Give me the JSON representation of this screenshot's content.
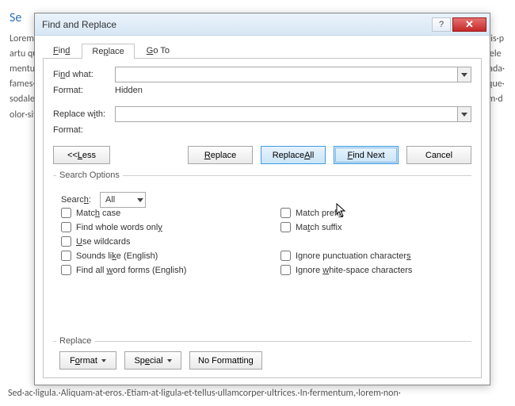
{
  "document": {
    "heading": "Se",
    "bg_text": "Lorem·ipsum·dolor·sit·amet.·Nam·at·magna.·Nullam·aliquet·massa·posuere·diam.·Cum·sociis·natoque·penatibus·et·magnis·dis·partu quis·mi.·Cras·auctor·libero·vitae·sem·vestibulum·euismod.·Sed·ve tristi·adipiscing·mauris·pellentesque·erat.·Sed·aliquet·elementum·erat.·vestit et·orci.·Donec·lacus·Aliquam·mauris.·Pellentesque·habitant·morbi·tristique·senectus·et·netus·et·malesuada·fames·ac·turpis·egestas.·mauris. scelerisque·sem·viverra·malesuada.·vestibulum·molestie·odio·a·nulla.·Aenean·at·lacus·tristique·sodales·congue·nisl·ut·sem·convallis.·Mauris·sollici Do lacini·magna·eget·ipsum.·Quisque·rutrum·augue·non·orci.·Lorem·ipsum·dolor·sit·amet·consectetuer·adipiscing·elit.·Mauris·vel·la.·vulpe.·in·nec·massa·quis·mi·porttitor·consequat.·¶",
    "footer_text": "Sed·ac·ligula.·Aliquam·at·eros.·Etiam·at·ligula·et·tellus·ullamcorper·ultrices.·In·fermentum,·lorem·non·"
  },
  "dialog": {
    "title": "Find and Replace",
    "tabs": {
      "find": "Find",
      "replace": "Replace",
      "goto": "Go To"
    },
    "find_what_label": "Find what:",
    "find_format_label": "Format:",
    "find_format_value": "Hidden",
    "replace_with_label": "Replace with:",
    "replace_format_label": "Format:",
    "buttons": {
      "less": "<< Less",
      "replace": "Replace",
      "replace_all": "Replace All",
      "find_next": "Find Next",
      "cancel": "Cancel"
    },
    "search_options_legend": "Search Options",
    "search_label": "Search:",
    "search_value": "All",
    "checkboxes": {
      "match_case": "Match case",
      "whole_words": "Find whole words only",
      "use_wildcards": "Use wildcards",
      "sounds_like": "Sounds like (English)",
      "word_forms": "Find all word forms (English)",
      "match_prefix": "Match prefix",
      "match_suffix": "Match suffix",
      "ignore_punct": "Ignore punctuation characters",
      "ignore_ws": "Ignore white-space characters"
    },
    "replace_legend": "Replace",
    "footer": {
      "format": "Format",
      "special": "Special",
      "no_formatting": "No Formatting"
    }
  }
}
